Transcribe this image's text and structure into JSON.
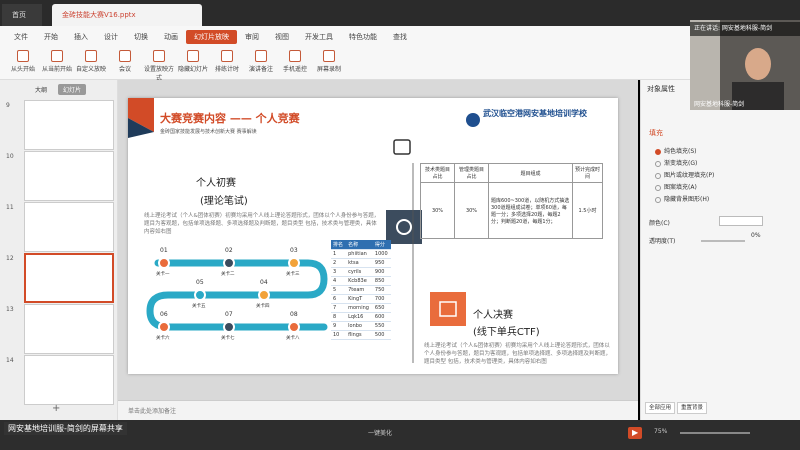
{
  "titlebar": {
    "home_tab": "首页",
    "file_tab": "金砖技能大赛V16.pptx"
  },
  "menu": [
    "文件",
    "开始",
    "插入",
    "设计",
    "切换",
    "动画",
    "幻灯片放映",
    "审阅",
    "视图",
    "开发工具",
    "特色功能",
    "查找"
  ],
  "menu_active": 6,
  "tools": [
    "从头开始",
    "从当前开始",
    "自定义放映",
    "会议",
    "设置放映方式",
    "隐藏幻灯片",
    "排练计时",
    "演讲备注",
    "手机遥控",
    "屏幕录制"
  ],
  "left_pane": {
    "tabs": [
      "大纲",
      "幻灯片"
    ],
    "thumbs": [
      "9",
      "10",
      "11",
      "12",
      "13",
      "14"
    ],
    "selected": 3,
    "add": "+"
  },
  "slide": {
    "title": "大赛竞赛内容 —— 个人竞赛",
    "subtitle": "金砖国家技能发展与技术创新大赛   赛事解读",
    "school": "武汉临空港网安基地培训学校",
    "prelim_title": "个人初赛",
    "prelim_sub": "(理论笔试)",
    "prelim_text": "线上理论考试（个人&团体初赛）初赛均采用个人线上理论答题形式，团体以个人身份参与答题，题目为客观题，包括单项选择题、多项选择题及判断题，题目类型 包括，技术类与管理类，具体内容如右图",
    "final_title": "个人决赛",
    "final_sub": "(线下单兵CTF)",
    "final_text": "线上理论考试（个人&团体初赛）初赛均采用个人线上理论答题形式，团体以个人身份参与答题，题目为客观题，包括单项选择题、多项选择题及判断题，题目类型 包括，技术类与管理类，具体内容如右图",
    "table_headers": [
      "技术类题目占比",
      "管理类题目占比",
      "题目组成",
      "预计完成时间"
    ],
    "table_row": [
      "30%",
      "30%",
      "题库600~300道，以随机方式抽选300道题组成试卷；单项60道，每题一分；多项选择20题，每题2分；判断题20道，每题1分；",
      "1.5小时"
    ],
    "rank_headers": [
      "排名",
      "名称",
      "得分"
    ],
    "rank_rows": [
      [
        "1",
        "phiitian",
        "1000"
      ],
      [
        "2",
        "ktsa",
        "950"
      ],
      [
        "3",
        "cyrils",
        "900"
      ],
      [
        "4",
        "Kcb83e",
        "850"
      ],
      [
        "5",
        "7team",
        "750"
      ],
      [
        "6",
        "KingT",
        "700"
      ],
      [
        "7",
        "morning",
        "650"
      ],
      [
        "8",
        "Lqk16",
        "600"
      ],
      [
        "9",
        "lonbo",
        "550"
      ],
      [
        "10",
        "flings",
        "500"
      ]
    ],
    "steps": [
      {
        "num": "01",
        "label": "关卡一"
      },
      {
        "num": "02",
        "label": "关卡二"
      },
      {
        "num": "03",
        "label": "关卡三"
      },
      {
        "num": "04",
        "label": "关卡四"
      },
      {
        "num": "05",
        "label": "关卡五"
      },
      {
        "num": "06",
        "label": "关卡六"
      },
      {
        "num": "07",
        "label": "关卡七"
      },
      {
        "num": "08",
        "label": "关卡八"
      }
    ]
  },
  "notes_placeholder": "单击此处添加备注",
  "right_pane": {
    "header": "对象属性",
    "section": "填充",
    "options": [
      "纯色填充(S)",
      "渐变填充(G)",
      "图片或纹理填充(P)",
      "图案填充(A)",
      "隐藏背景图形(H)"
    ],
    "selected_option": 0,
    "color_label": "颜色(C)",
    "transparency_label": "透明度(T)",
    "transparency_value": "0%",
    "btn_all": "全部应用",
    "btn_reset": "重置背景"
  },
  "status": {
    "share_text": "网安基地培训服-简剑的屏幕共享",
    "beautify": "一键美化",
    "zoom": "75%"
  },
  "webcam": {
    "speaking": "正在讲话: 网安基地科服-简剑",
    "name": "网安基地科服-简剑"
  },
  "colors": {
    "accent": "#d24b27",
    "blue": "#2f6fb0"
  }
}
